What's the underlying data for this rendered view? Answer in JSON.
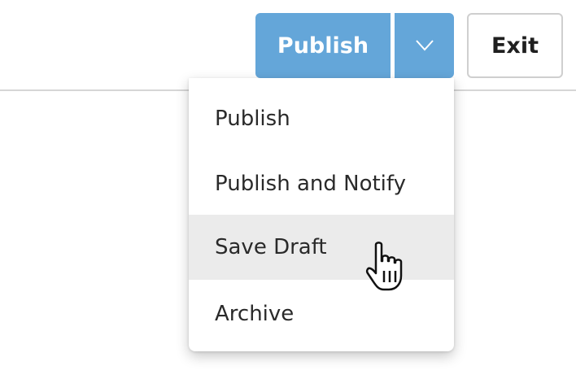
{
  "toolbar": {
    "publish_label": "Publish",
    "exit_label": "Exit",
    "toggle_icon": "chevron-down-icon"
  },
  "menu": {
    "items": [
      {
        "label": "Publish"
      },
      {
        "label": "Publish and Notify"
      },
      {
        "label": "Save Draft",
        "hovered": true
      },
      {
        "label": "Archive"
      }
    ]
  },
  "cursor": {
    "icon": "hand-pointer-icon"
  },
  "colors": {
    "primary": "#64a6d9",
    "hover_bg": "#ebebeb",
    "text": "#2a2a2a",
    "divider": "#d6d6d6"
  }
}
